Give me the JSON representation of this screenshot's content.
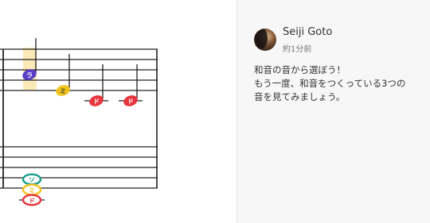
{
  "score": {
    "treble_notes": [
      {
        "syllable": "ラ",
        "color": "#5a3fc8",
        "text_color": "#ffffff",
        "highlighted": true
      },
      {
        "syllable": "ミ",
        "color": "#f1c21b",
        "text_color": "#333333",
        "highlighted": false
      },
      {
        "syllable": "ド",
        "color": "#e8343e",
        "text_color": "#ffffff",
        "highlighted": false
      },
      {
        "syllable": "ド",
        "color": "#e8343e",
        "text_color": "#ffffff",
        "highlighted": false
      }
    ],
    "bass_chord": [
      {
        "syllable": "ソ",
        "color": "#1a9e8c"
      },
      {
        "syllable": "ミ",
        "color": "#f1c21b"
      },
      {
        "syllable": "ド",
        "color": "#e8343e"
      }
    ],
    "highlight_color": "#fbe9b8"
  },
  "comment": {
    "author": "Seiji Goto",
    "time": "約1分前",
    "lines": [
      "和音の音から選ぼう！",
      "もう一度、和音をつくっている3つの",
      "音を見てみましょう。"
    ]
  }
}
